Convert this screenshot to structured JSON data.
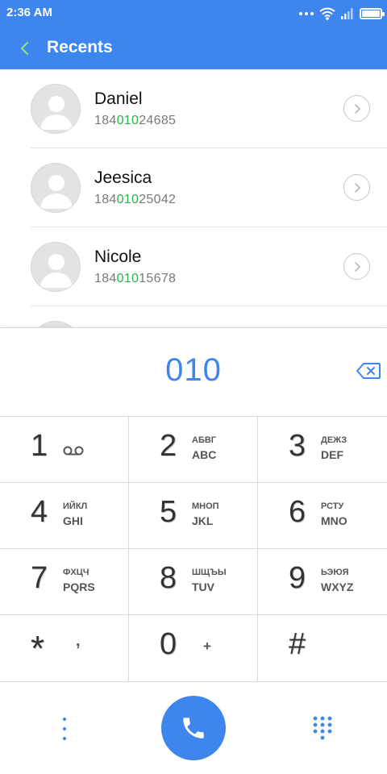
{
  "status_bar": {
    "time": "2:36 AM"
  },
  "app_bar": {
    "title": "Recents"
  },
  "recents": [
    {
      "name": "Daniel",
      "number_prefix": "184",
      "number_match": "010",
      "number_suffix": "24685"
    },
    {
      "name": "Jeesica",
      "number_prefix": "184",
      "number_match": "010",
      "number_suffix": "25042"
    },
    {
      "name": "Nicole",
      "number_prefix": "184",
      "number_match": "010",
      "number_suffix": "15678"
    }
  ],
  "dialer": {
    "entered_number": "010"
  },
  "keypad": {
    "key_1": {
      "digit": "1"
    },
    "key_2": {
      "digit": "2",
      "ru": "АБВГ",
      "en": "ABC"
    },
    "key_3": {
      "digit": "3",
      "ru": "ДЕЖЗ",
      "en": "DEF"
    },
    "key_4": {
      "digit": "4",
      "ru": "ИЙКЛ",
      "en": "GHI"
    },
    "key_5": {
      "digit": "5",
      "ru": "МНОП",
      "en": "JKL"
    },
    "key_6": {
      "digit": "6",
      "ru": "РСТУ",
      "en": "MNO"
    },
    "key_7": {
      "digit": "7",
      "ru": "ФХЦЧ",
      "en": "PQRS"
    },
    "key_8": {
      "digit": "8",
      "ru": "ШЩЪЫ",
      "en": "TUV"
    },
    "key_9": {
      "digit": "9",
      "ru": "ЬЭЮЯ",
      "en": "WXYZ"
    },
    "key_star": {
      "digit": "*",
      "sub": ","
    },
    "key_0": {
      "digit": "0",
      "sub": "+"
    },
    "key_hash": {
      "digit": "#"
    }
  },
  "colors": {
    "accent": "#3f85ee",
    "match_highlight": "#2bb24c",
    "back_arrow": "#8ee08e"
  },
  "icons": {
    "back": "chevron-left-icon",
    "arrow": "chevron-right-icon",
    "backspace": "backspace-icon",
    "voicemail": "voicemail-icon",
    "call": "phone-icon",
    "menu": "more-vertical-icon",
    "keypad": "dialpad-icon"
  }
}
